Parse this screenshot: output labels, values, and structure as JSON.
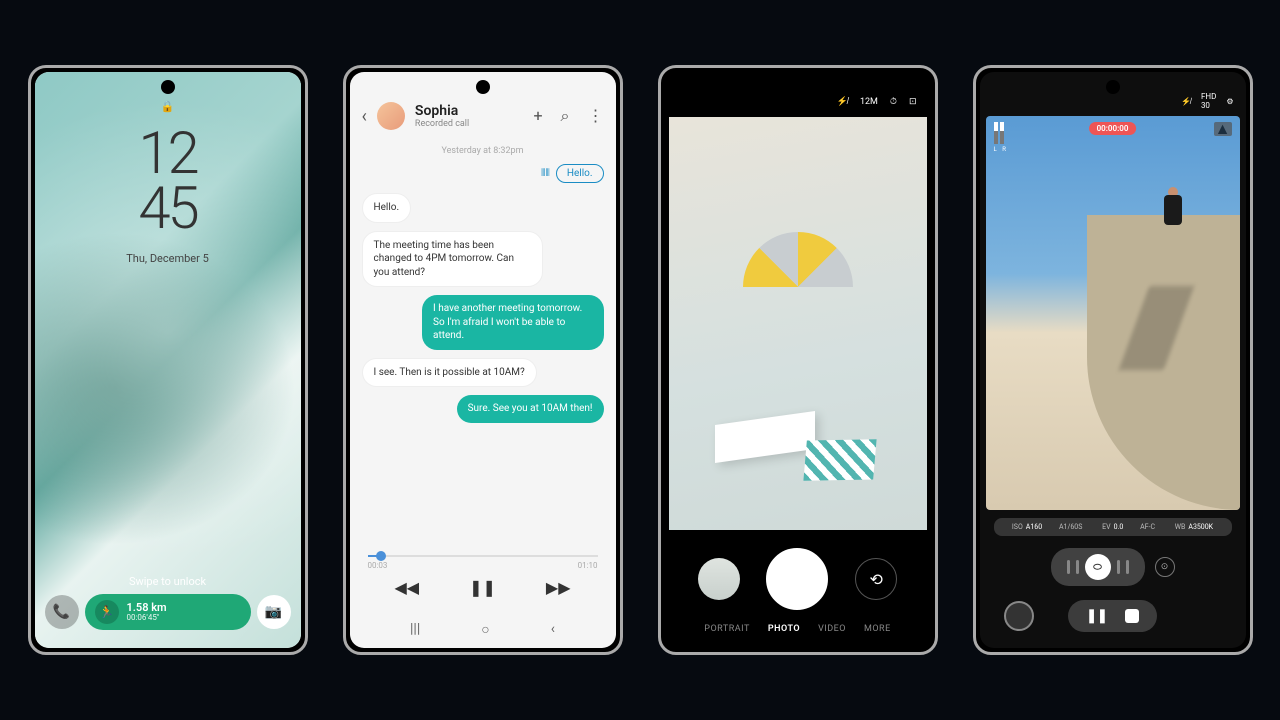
{
  "phone1": {
    "time_top": "12",
    "time_bottom": "45",
    "date": "Thu, December 5",
    "swipe": "Swipe to unlock",
    "run_distance": "1.58 km",
    "run_time": "00:06'45\""
  },
  "phone2": {
    "contact_name": "Sophia",
    "contact_sub": "Recorded call",
    "timestamp": "Yesterday at 8:32pm",
    "transcript_hello": "Hello.",
    "msg1": "Hello.",
    "msg2": "The meeting time has been changed to 4PM tomorrow. Can you attend?",
    "msg3": "I have another meeting tomorrow. So I'm afraid I won't be able to attend.",
    "msg4": "I see. Then is it possible at 10AM?",
    "msg5": "Sure. See you at 10AM then!",
    "time_current": "00:03",
    "time_total": "01:10"
  },
  "phone3": {
    "megapixel": "12M",
    "mode_portrait": "PORTRAIT",
    "mode_photo": "PHOTO",
    "mode_video": "VIDEO",
    "mode_more": "MORE"
  },
  "phone4": {
    "fhd": "FHD",
    "fps": "30",
    "audio_lr": "L R",
    "rec_time": "00:00:00",
    "iso_lbl": "ISO",
    "iso_val": "A160",
    "sp_val": "A1/60S",
    "ev_lbl": "EV",
    "ev_val": "0.0",
    "af_val": "AF-C",
    "wb_lbl": "WB",
    "wb_val": "A3500K"
  }
}
